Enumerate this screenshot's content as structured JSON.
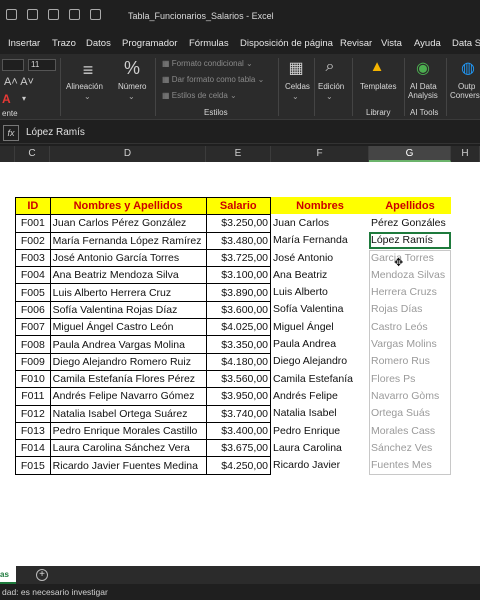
{
  "window": {
    "title": "Tabla_Funcionarios_Salarios - Excel"
  },
  "tabs": [
    "Insertar",
    "Trazo",
    "Datos",
    "Programador",
    "Fórmulas",
    "Disposición de página",
    "Revisar",
    "Vista",
    "Ayuda",
    "Data St"
  ],
  "ribbon": {
    "font_size": "11",
    "alineacion": "Alineación",
    "numero": "Número",
    "cond_format": "Formato condicional",
    "table_format": "Dar formato como tabla",
    "cell_styles": "Estilos de celda",
    "estilos": "Estilos",
    "celdas": "Celdas",
    "edicion": "Edición",
    "templates": "Templates",
    "library": "Library",
    "ai_data": "AI Data",
    "analysis": "Analysis",
    "ai_tools": "AI Tools",
    "output": "Outp",
    "conversion": "Conversi",
    "fuente_frag": "ente"
  },
  "formula_bar": {
    "fx": "fx",
    "value": "López Ramís"
  },
  "columns": [
    "C",
    "D",
    "E",
    "F",
    "G",
    "H"
  ],
  "table_headers": {
    "id": "ID",
    "name": "Nombres y Apellidos",
    "salary": "Salario",
    "nombres": "Nombres",
    "apellidos": "Apellidos"
  },
  "rows": [
    {
      "id": "F001",
      "name": "Juan Carlos Pérez González",
      "salary": "$3.250,00",
      "first": "Juan Carlos",
      "last": "Pérez Gonzáles"
    },
    {
      "id": "F002",
      "name": "María Fernanda López Ramírez",
      "salary": "$3.480,00",
      "first": "María Fernanda",
      "last": "López Ramís"
    },
    {
      "id": "F003",
      "name": "José Antonio García Torres",
      "salary": "$3.725,00",
      "first": "José Antonio",
      "last": "Garcia Torres"
    },
    {
      "id": "F004",
      "name": "Ana Beatriz Mendoza Silva",
      "salary": "$3.100,00",
      "first": "Ana Beatriz",
      "last": "Mendoza Silvas"
    },
    {
      "id": "F005",
      "name": "Luis Alberto Herrera Cruz",
      "salary": "$3.890,00",
      "first": "Luis Alberto",
      "last": "Herrera Cruzs"
    },
    {
      "id": "F006",
      "name": "Sofía Valentina Rojas Díaz",
      "salary": "$3.600,00",
      "first": "Sofía Valentina",
      "last": "Rojas Días"
    },
    {
      "id": "F007",
      "name": "Miguel Ángel Castro León",
      "salary": "$4.025,00",
      "first": "Miguel Ángel",
      "last": "Castro Leós"
    },
    {
      "id": "F008",
      "name": "Paula Andrea Vargas Molina",
      "salary": "$3.350,00",
      "first": "Paula Andrea",
      "last": "Vargas Molins"
    },
    {
      "id": "F009",
      "name": "Diego Alejandro Romero Ruiz",
      "salary": "$4.180,00",
      "first": "Diego Alejandro",
      "last": "Romero Rus"
    },
    {
      "id": "F010",
      "name": "Camila Estefanía Flores Pérez",
      "salary": "$3.560,00",
      "first": "Camila Estefanía",
      "last": "Flores Ps"
    },
    {
      "id": "F011",
      "name": "Andrés Felipe Navarro Gómez",
      "salary": "$3.950,00",
      "first": "Andrés Felipe",
      "last": "Navarro Gòms"
    },
    {
      "id": "F012",
      "name": "Natalia Isabel Ortega Suárez",
      "salary": "$3.740,00",
      "first": "Natalia Isabel",
      "last": "Ortega Suás"
    },
    {
      "id": "F013",
      "name": "Pedro Enrique Morales Castillo",
      "salary": "$3.400,00",
      "first": "Pedro Enrique",
      "last": "Morales Cass"
    },
    {
      "id": "F014",
      "name": "Laura Carolina Sánchez Vera",
      "salary": "$3.675,00",
      "first": "Laura Carolina",
      "last": "Sánchez Ves"
    },
    {
      "id": "F015",
      "name": "Ricardo Javier Fuentes Medina",
      "salary": "$4.250,00",
      "first": "Ricardo Javier",
      "last": "Fuentes Mes"
    }
  ],
  "sheet_tabs": {
    "active": "as",
    "add": "+"
  },
  "status_bar": "dad: es necesario investigar",
  "colors": {
    "header_fill": "#ffff00",
    "header_text": "#cc0000",
    "selection": "#1e7a3c",
    "ghost_text": "#9a9a9a"
  }
}
